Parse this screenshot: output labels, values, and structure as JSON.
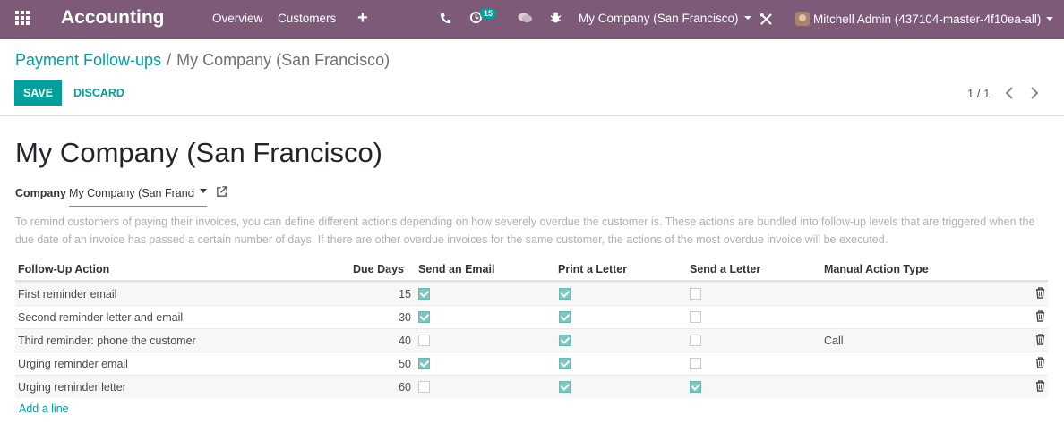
{
  "navbar": {
    "app_name": "Accounting",
    "menu": [
      "Overview",
      "Customers"
    ],
    "activity_count": "15",
    "company": "My Company (San Francisco)",
    "user": "Mitchell Admin (437104-master-4f10ea-all)"
  },
  "breadcrumb": {
    "parent": "Payment Follow-ups",
    "separator": "/",
    "current": "My Company (San Francisco)"
  },
  "toolbar": {
    "save_label": "SAVE",
    "discard_label": "DISCARD",
    "pager": "1 / 1"
  },
  "form": {
    "title": "My Company (San Francisco)",
    "company_label": "Company",
    "company_value": "My Company (San Francisco)",
    "help": "To remind customers of paying their invoices, you can define different actions depending on how severely overdue the customer is. These actions are bundled into follow-up levels that are triggered when the due date of an invoice has passed a certain number of days. If there are other overdue invoices for the same customer, the actions of the most overdue invoice will be executed."
  },
  "table": {
    "headers": {
      "action": "Follow-Up Action",
      "due_days": "Due Days",
      "send_email": "Send an Email",
      "print_letter": "Print a Letter",
      "send_letter": "Send a Letter",
      "manual_action": "Manual Action Type"
    },
    "rows": [
      {
        "action": "First reminder email",
        "due_days": "15",
        "send_email": true,
        "print_letter": true,
        "send_letter": false,
        "manual_action": ""
      },
      {
        "action": "Second reminder letter and email",
        "due_days": "30",
        "send_email": true,
        "print_letter": true,
        "send_letter": false,
        "manual_action": ""
      },
      {
        "action": "Third reminder: phone the customer",
        "due_days": "40",
        "send_email": false,
        "print_letter": true,
        "send_letter": false,
        "manual_action": "Call"
      },
      {
        "action": "Urging reminder email",
        "due_days": "50",
        "send_email": true,
        "print_letter": true,
        "send_letter": false,
        "manual_action": ""
      },
      {
        "action": "Urging reminder letter",
        "due_days": "60",
        "send_email": false,
        "print_letter": true,
        "send_letter": true,
        "manual_action": ""
      }
    ],
    "add_line": "Add a line"
  },
  "colors": {
    "navbar": "#7c5a78",
    "accent": "#00a09d"
  }
}
